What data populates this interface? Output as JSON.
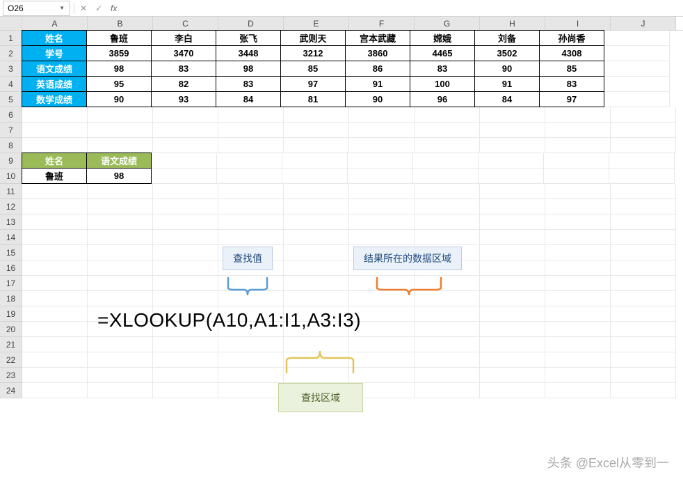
{
  "name_box": "O26",
  "formula_input": "",
  "columns": [
    "A",
    "B",
    "C",
    "D",
    "E",
    "F",
    "G",
    "H",
    "I",
    "J"
  ],
  "chart_data": {
    "type": "table",
    "row_headers": [
      "姓名",
      "学号",
      "语文成绩",
      "英语成绩",
      "数学成绩"
    ],
    "col_names": [
      "鲁班",
      "李白",
      "张飞",
      "武则天",
      "宫本武藏",
      "嫦娥",
      "刘备",
      "孙尚香"
    ],
    "rows": [
      [
        "3859",
        "3470",
        "3448",
        "3212",
        "3860",
        "4465",
        "3502",
        "4308"
      ],
      [
        "98",
        "83",
        "98",
        "85",
        "86",
        "83",
        "90",
        "85"
      ],
      [
        "95",
        "82",
        "83",
        "97",
        "91",
        "100",
        "91",
        "83"
      ],
      [
        "90",
        "93",
        "84",
        "81",
        "90",
        "96",
        "84",
        "97"
      ]
    ]
  },
  "lookup_table": {
    "headers": [
      "姓名",
      "语文成绩"
    ],
    "row": [
      "鲁班",
      "98"
    ]
  },
  "annotations": {
    "lookup_value": "查找值",
    "result_range": "结果所在的数据区域",
    "lookup_range": "查找区域"
  },
  "formula": "=XLOOKUP(A10,A1:I1,A3:I3)",
  "watermark": "头条 @Excel从零到一"
}
